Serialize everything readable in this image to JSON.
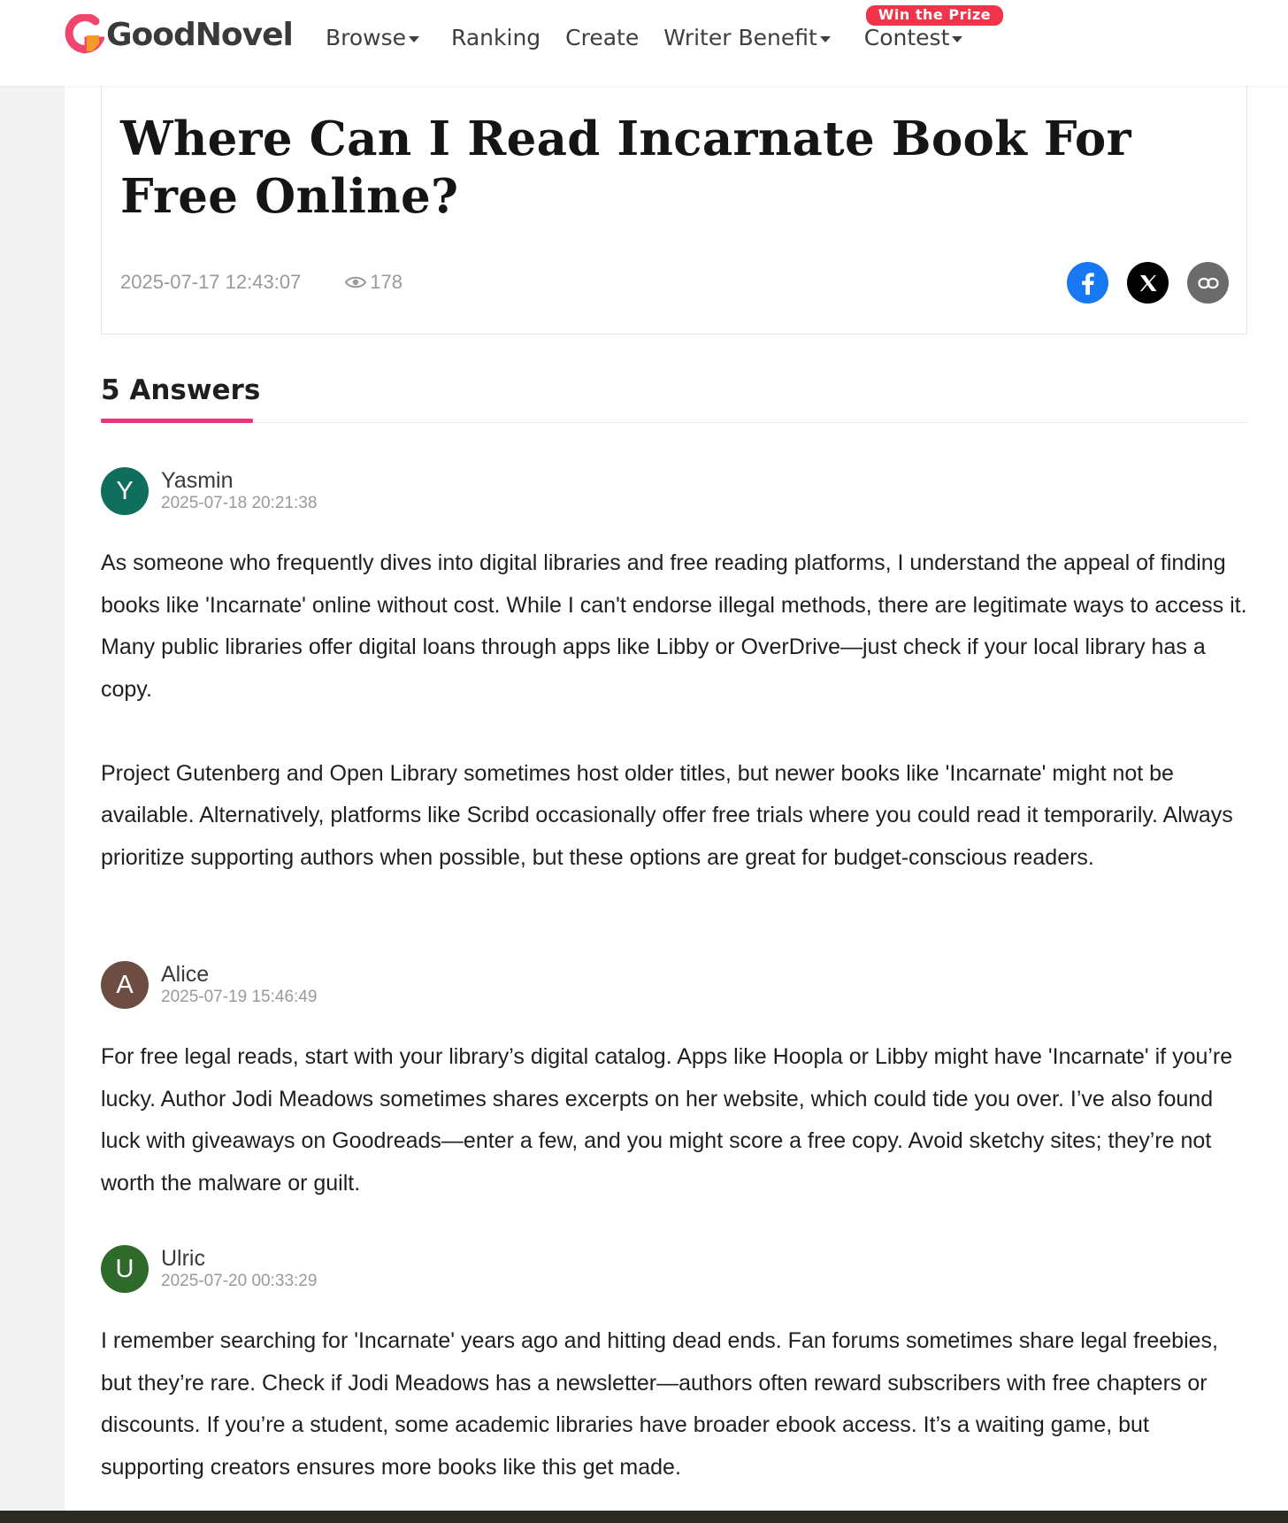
{
  "header": {
    "logo_text": "GoodNovel",
    "nav": [
      {
        "label": "Browse",
        "caret": true
      },
      {
        "label": "Ranking",
        "caret": false
      },
      {
        "label": "Create",
        "caret": false
      },
      {
        "label": "Writer Benefit",
        "caret": true
      },
      {
        "label": "Contest",
        "caret": true
      }
    ],
    "prize_badge": "Win the Prize"
  },
  "question": {
    "title": "Where Can I Read Incarnate Book For Free Online?",
    "date": "2025-07-17 12:43:07",
    "views": "178",
    "share_icons": [
      "facebook-icon",
      "x-icon",
      "link-icon"
    ]
  },
  "answers_heading": "5 Answers",
  "answers": [
    {
      "initial": "Y",
      "name": "Yasmin",
      "date": "2025-07-18 20:21:38",
      "avatar_color": "#0f6e5c",
      "paragraphs": [
        "As someone who frequently dives into digital libraries and free reading platforms, I understand the appeal of finding books like 'Incarnate' online without cost. While I can't endorse illegal methods, there are legitimate ways to access it. Many public libraries offer digital loans through apps like Libby or OverDrive—just check if your local library has a copy.",
        "Project Gutenberg and Open Library sometimes host older titles, but newer books like 'Incarnate' might not be available. Alternatively, platforms like Scribd occasionally offer free trials where you could read it temporarily. Always prioritize supporting authors when possible, but these options are great for budget-conscious readers."
      ]
    },
    {
      "initial": "A",
      "name": "Alice",
      "date": "2025-07-19 15:46:49",
      "avatar_color": "#6d4c41",
      "paragraphs": [
        "For free legal reads, start with your library’s digital catalog. Apps like Hoopla or Libby might have 'Incarnate' if you’re lucky. Author Jodi Meadows sometimes shares excerpts on her website, which could tide you over. I’ve also found luck with giveaways on Goodreads—enter a few, and you might score a free copy. Avoid sketchy sites; they’re not worth the malware or guilt."
      ]
    },
    {
      "initial": "U",
      "name": "Ulric",
      "date": "2025-07-20 00:33:29",
      "avatar_color": "#2e6b2a",
      "paragraphs": [
        "I remember searching for 'Incarnate' years ago and hitting dead ends. Fan forums sometimes share legal freebies, but they’re rare. Check if Jodi Meadows has a newsletter—authors often reward subscribers with free chapters or discounts. If you’re a student, some academic libraries have broader ebook access. It’s a waiting game, but supporting creators ensures more books like this get made."
      ]
    }
  ],
  "colors": {
    "accent": "#e7357a",
    "prize": "#f0344a",
    "facebook": "#1877f2"
  }
}
